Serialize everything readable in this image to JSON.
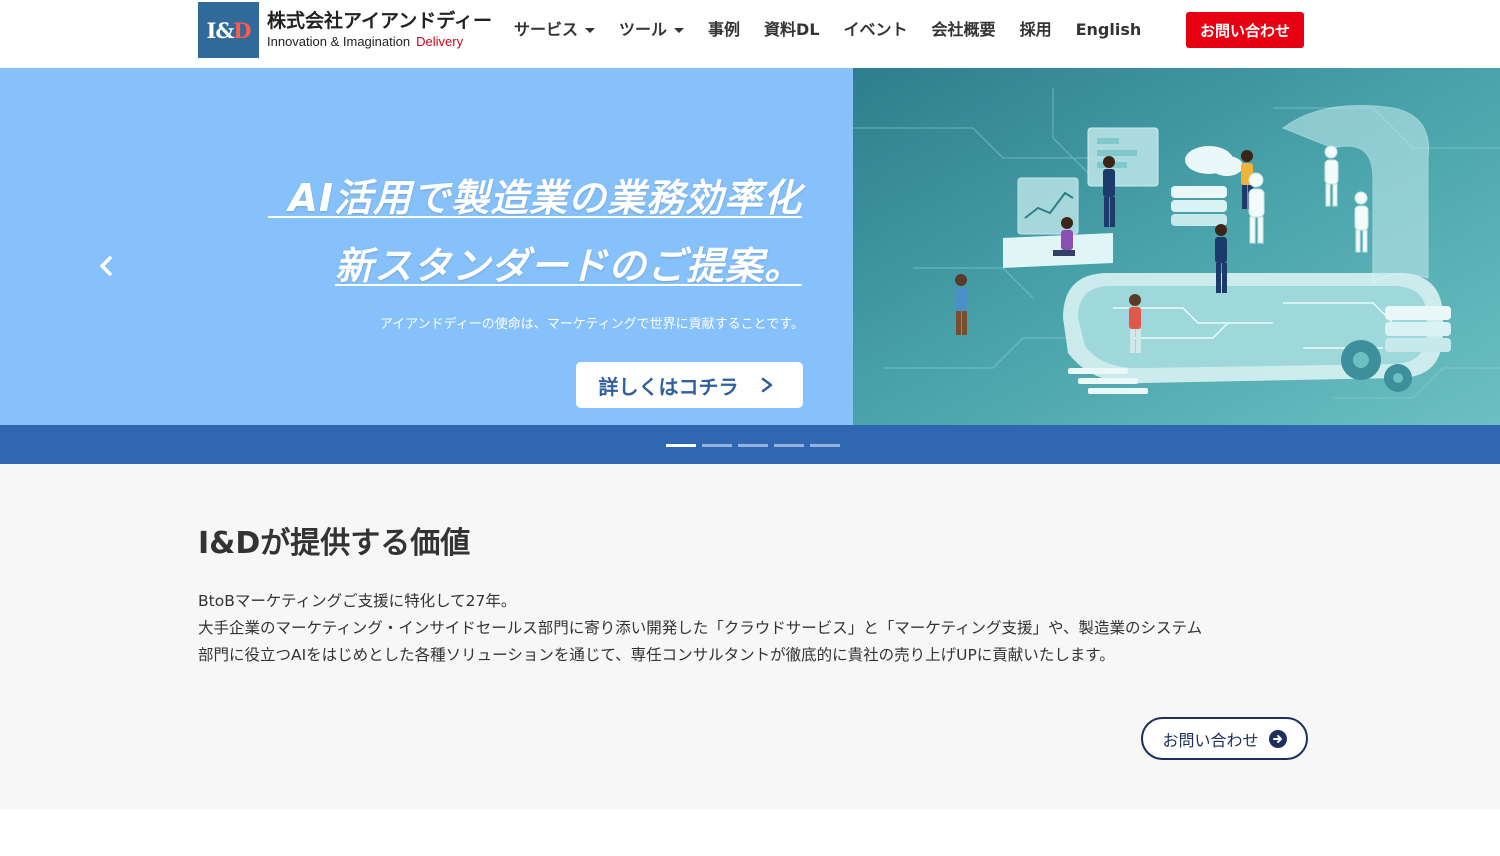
{
  "brand": {
    "mark": "I&D",
    "name": "株式会社アイアンドディー",
    "tagline": "Innovation & Imagination",
    "tagline_accent": "Delivery"
  },
  "nav": {
    "items": [
      {
        "label": "サービス",
        "dropdown": true
      },
      {
        "label": "ツール",
        "dropdown": true
      },
      {
        "label": "事例",
        "dropdown": false
      },
      {
        "label": "資料DL",
        "dropdown": false
      },
      {
        "label": "イベント",
        "dropdown": false
      },
      {
        "label": "会社概要",
        "dropdown": false
      },
      {
        "label": "採用",
        "dropdown": false
      },
      {
        "label": "English",
        "dropdown": false
      }
    ],
    "contact_label": "お問い合わせ"
  },
  "hero": {
    "headline_1": "AI活用で製造業の業務効率化",
    "headline_2": "新スタンダードのご提案。",
    "subtext": "アイアンドディーの使命は、マーケティングで世界に貢献することです。",
    "cta_label": "詳しくはコチラ",
    "cta_icon": "chevron-right-icon",
    "prev_icon": "chevron-left-icon",
    "slide_count": 5,
    "active_slide": 1
  },
  "value": {
    "title": "I&Dが提供する価値",
    "lines": [
      "BtoBマーケティングご支援に特化して27年。",
      "大手企業のマーケティング・インサイドセールス部門に寄り添い開発した「クラウドサービス」と「マーケティング支援」や、製造業のシステム",
      "部門に役立つAIをはじめとした各種ソリューションを通じて、専任コンサルタントが徹底的に貴社の売り上げUPに貢献いたします。"
    ],
    "contact_label": "お問い合わせ",
    "contact_icon": "arrow-circle-right-icon"
  },
  "colors": {
    "brand_red": "#e60012",
    "hero_blue": "#86c1fb",
    "indicator_blue": "#2f67b2",
    "navy": "#1f2f5c"
  }
}
